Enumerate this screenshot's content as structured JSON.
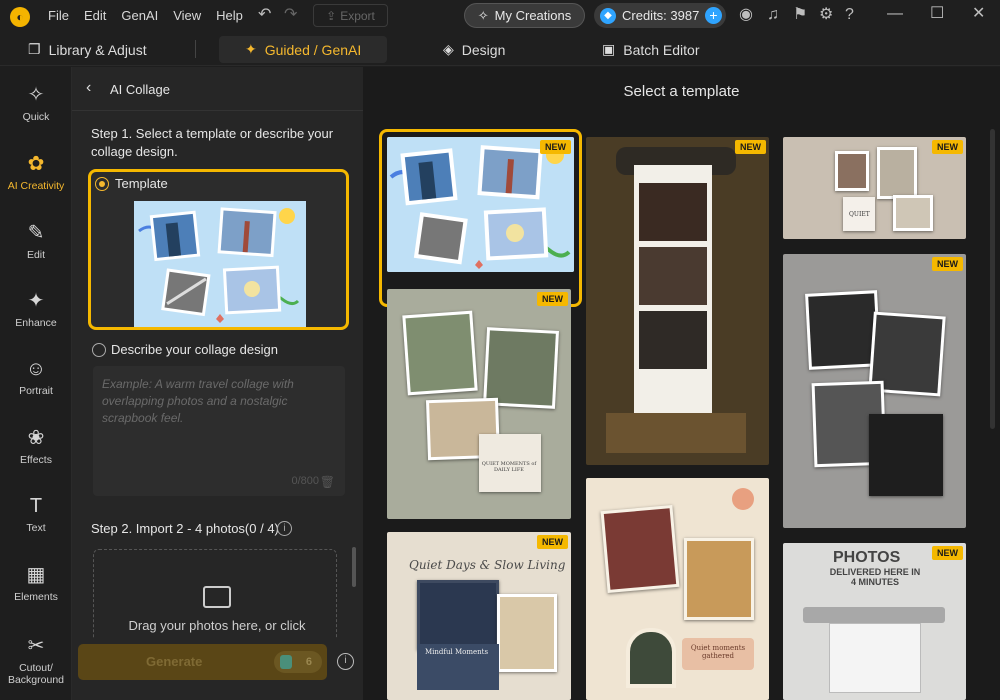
{
  "menu": [
    "File",
    "Edit",
    "GenAI",
    "View",
    "Help"
  ],
  "toolbar": {
    "export_label": "Export",
    "my_creations_label": "My Creations",
    "credits_label": "Credits: 3987"
  },
  "tabs": [
    {
      "label": "Library & Adjust",
      "icon": "library-icon"
    },
    {
      "label": "Guided / GenAI",
      "icon": "guided-icon",
      "active": true
    },
    {
      "label": "Design",
      "icon": "layers-icon"
    },
    {
      "label": "Batch Editor",
      "icon": "image-stack-icon"
    }
  ],
  "rail": [
    {
      "label": "Quick",
      "icon": "magic-wand-icon"
    },
    {
      "label": "AI Creativity",
      "icon": "ai-creativity-icon",
      "active": true
    },
    {
      "label": "Edit",
      "icon": "edit-icon"
    },
    {
      "label": "Enhance",
      "icon": "enhance-icon"
    },
    {
      "label": "Portrait",
      "icon": "portrait-icon"
    },
    {
      "label": "Effects",
      "icon": "effects-icon"
    },
    {
      "label": "Text",
      "icon": "text-icon"
    },
    {
      "label": "Elements",
      "icon": "elements-icon"
    },
    {
      "label": "Cutout/ Background",
      "icon": "cutout-icon"
    }
  ],
  "panel": {
    "title": "AI Collage",
    "step1": "Step 1. Select a template or describe your collage design.",
    "template_label": "Template",
    "describe_label": "Describe your collage design",
    "describe_placeholder": "Example: A warm travel collage with overlapping photos and a nostalgic scrapbook feel.",
    "char_count": "0/800",
    "step2": "Step 2. Import 2 - 4 photos(0 / 4)",
    "drop_text": "Drag your photos here, or click",
    "generate_label": "Generate",
    "generate_cost": "6"
  },
  "gallery": {
    "title": "Select a template",
    "badge": "NEW",
    "captions": {
      "moments": "QUIET MOMENTS of DAILY LIFE",
      "quiet_days": "Quiet Days & Slow Living",
      "mindful": "Mindful Moments",
      "quiet_gathered": "Quiet moments gathered",
      "quiet": "QUIET",
      "photos": "PHOTOS",
      "delivered": "DELIVERED HERE IN 4 MINUTES"
    }
  },
  "colors": {
    "accent": "#f5b800",
    "panel_bg": "#262626",
    "gallery_bg": "#1b1b1b"
  }
}
